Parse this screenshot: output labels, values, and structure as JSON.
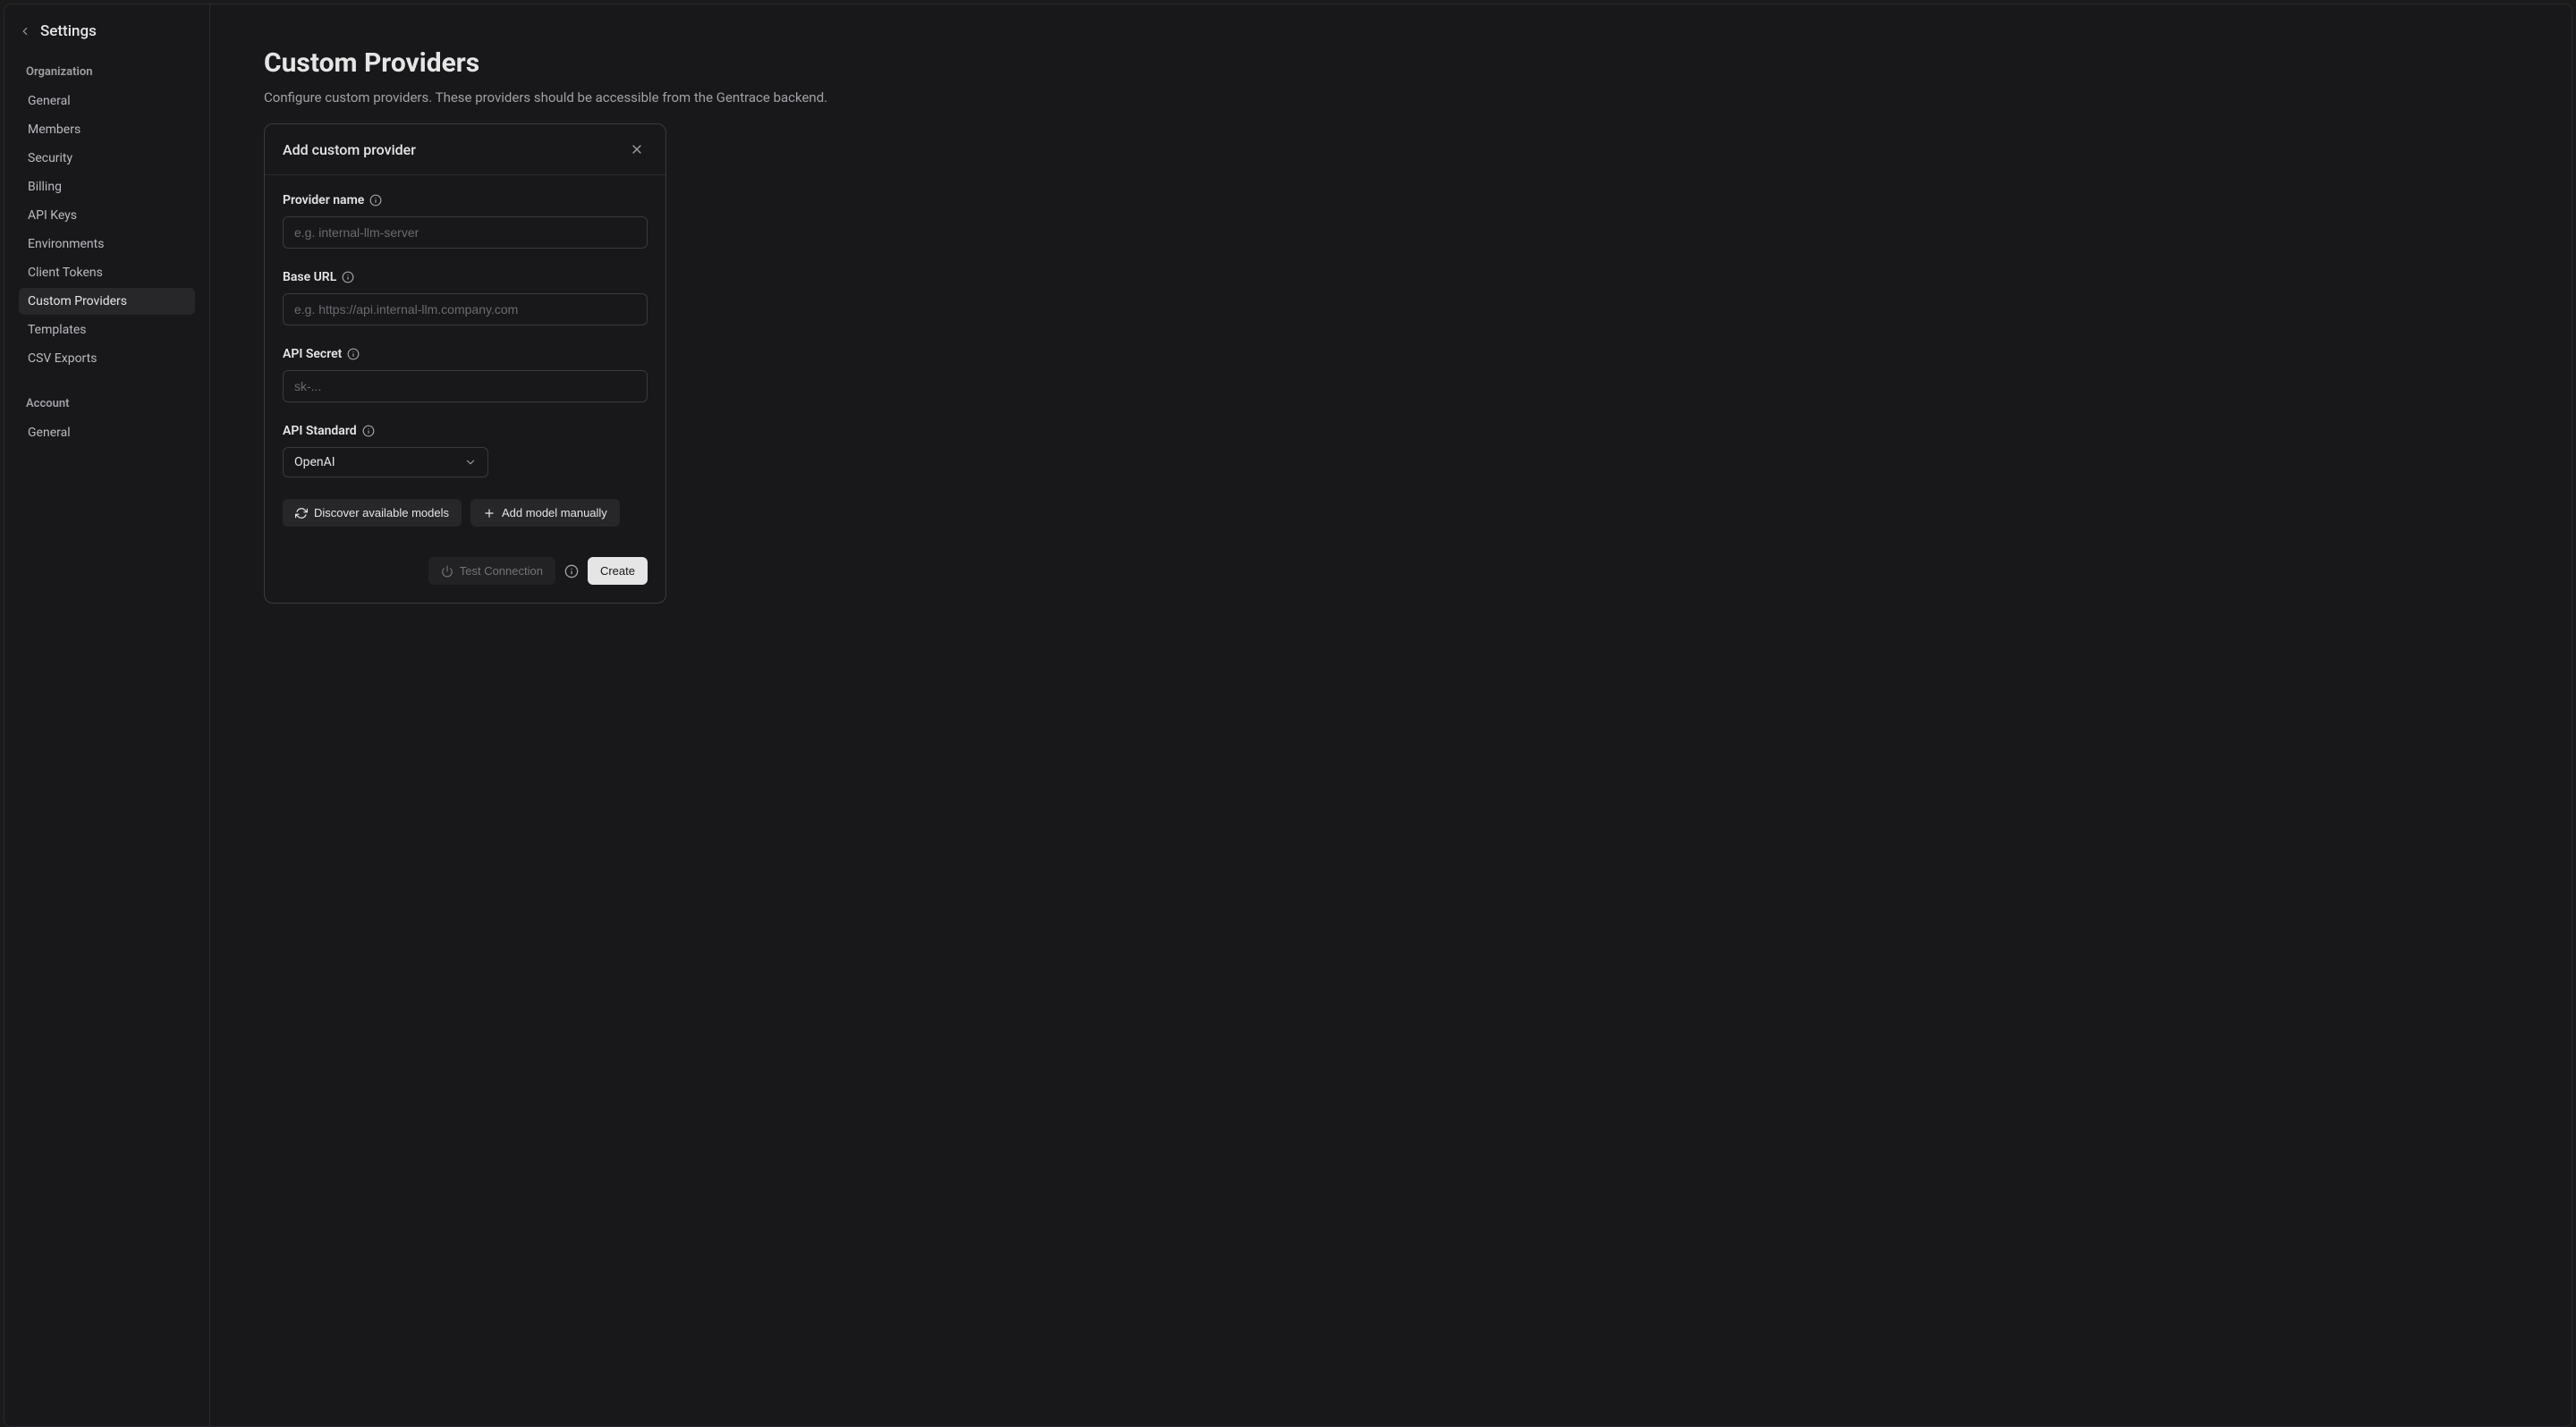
{
  "sidebar": {
    "title": "Settings",
    "sections": [
      {
        "label": "Organization",
        "items": [
          {
            "label": "General",
            "active": false
          },
          {
            "label": "Members",
            "active": false
          },
          {
            "label": "Security",
            "active": false
          },
          {
            "label": "Billing",
            "active": false
          },
          {
            "label": "API Keys",
            "active": false
          },
          {
            "label": "Environments",
            "active": false
          },
          {
            "label": "Client Tokens",
            "active": false
          },
          {
            "label": "Custom Providers",
            "active": true
          },
          {
            "label": "Templates",
            "active": false
          },
          {
            "label": "CSV Exports",
            "active": false
          }
        ]
      },
      {
        "label": "Account",
        "items": [
          {
            "label": "General",
            "active": false
          }
        ]
      }
    ]
  },
  "page": {
    "title": "Custom Providers",
    "description": "Configure custom providers. These providers should be accessible from the Gentrace backend."
  },
  "modal": {
    "title": "Add custom provider",
    "fields": {
      "provider_name": {
        "label": "Provider name",
        "placeholder": "e.g. internal-llm-server",
        "value": ""
      },
      "base_url": {
        "label": "Base URL",
        "placeholder": "e.g. https://api.internal-llm.company.com",
        "value": ""
      },
      "api_secret": {
        "label": "API Secret",
        "placeholder": "sk-...",
        "value": ""
      },
      "api_standard": {
        "label": "API Standard",
        "selected": "OpenAI"
      }
    },
    "buttons": {
      "discover": "Discover available models",
      "add_manual": "Add model manually",
      "test": "Test Connection",
      "create": "Create"
    }
  }
}
